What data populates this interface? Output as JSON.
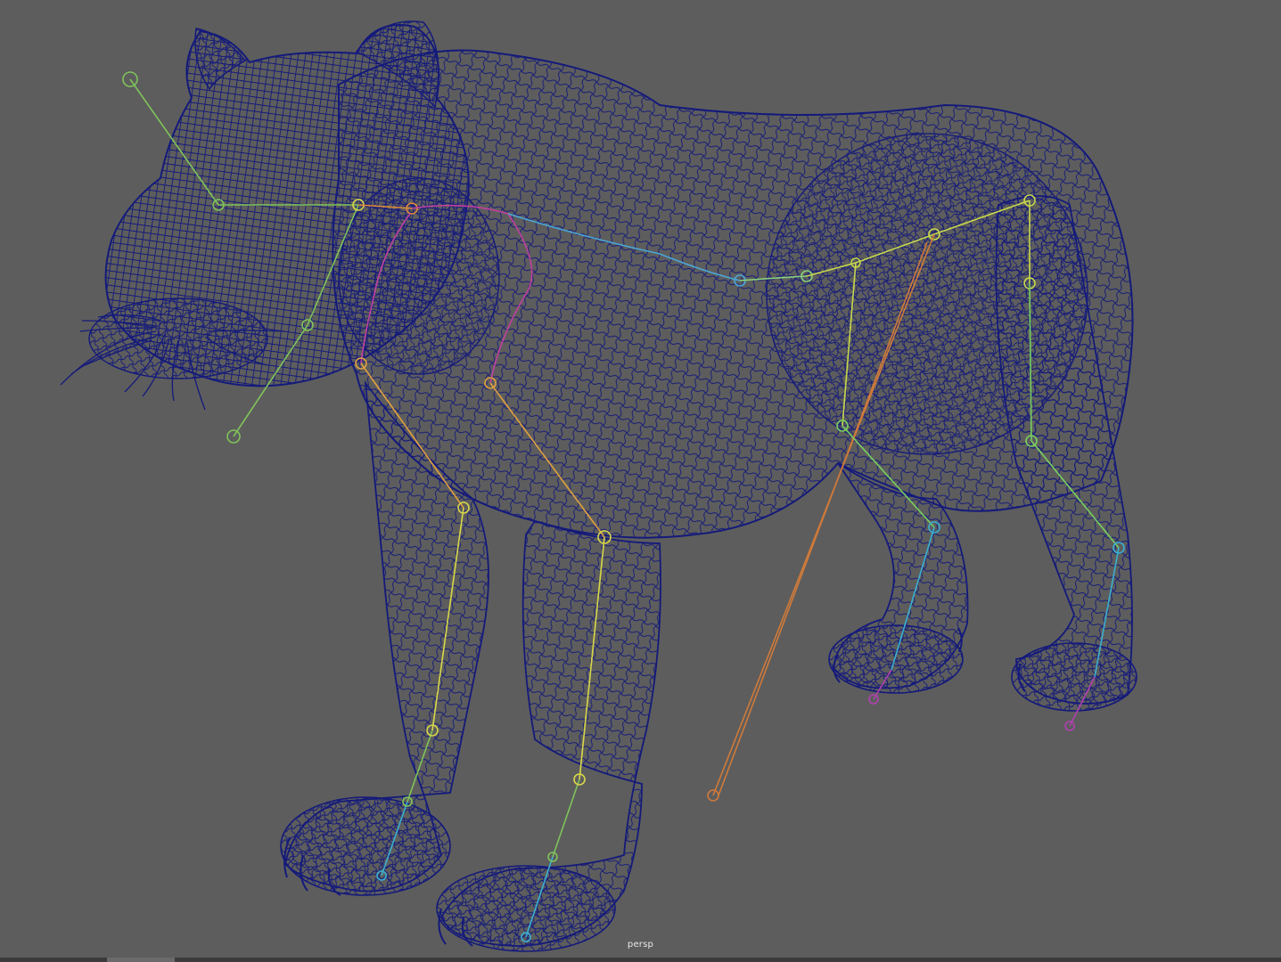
{
  "viewport": {
    "camera_label": "persp",
    "background_color": "#5d5d5d",
    "wireframe_color": "#141a7a"
  },
  "rig": {
    "joint_colors": {
      "head": "#7fc35a",
      "spine": "#4aa6d6",
      "neck": "#c040a0",
      "front_leg_left": "#d8d84a",
      "front_leg_right": "#e0c050",
      "ik_handle": "#d07a3a",
      "hind_leg": "#78d060",
      "paw": "#3ab0d0",
      "toe": "#b040b0"
    }
  }
}
